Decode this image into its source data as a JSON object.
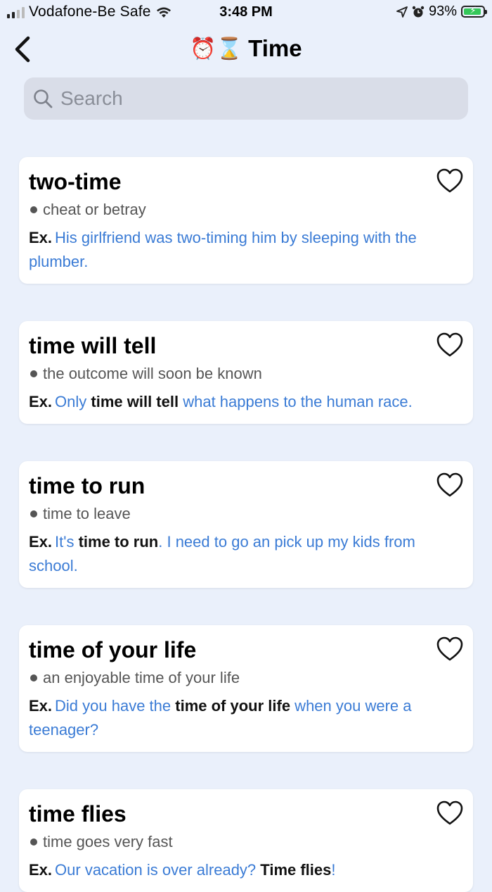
{
  "status_bar": {
    "carrier": "Vodafone-Be Safe",
    "time": "3:48 PM",
    "battery_percent": "93%",
    "battery_level": 0.93,
    "battery_color": "#34c759"
  },
  "nav": {
    "back_icon": "chevron-left-icon",
    "title_emoji": "⏰⌛",
    "title": "Time"
  },
  "search": {
    "placeholder": "Search",
    "value": ""
  },
  "colors": {
    "background": "#eaf0fb",
    "example_text": "#3a7bd5",
    "card": "#ffffff"
  },
  "example_label": "Ex.",
  "cards": [
    {
      "title": "two-time",
      "meaning": "cheat or betray",
      "example_parts": [
        {
          "text": "His girlfriend was two-timing him by sleeping with the plumber.",
          "bold": false
        }
      ],
      "favorite": false
    },
    {
      "title": "time will tell",
      "meaning": "the outcome will soon be known",
      "example_parts": [
        {
          "text": "Only ",
          "bold": false
        },
        {
          "text": "time will tell",
          "bold": true
        },
        {
          "text": " what happens to the human race.",
          "bold": false
        }
      ],
      "favorite": false
    },
    {
      "title": "time to run",
      "meaning": "time to leave",
      "example_parts": [
        {
          "text": "It's ",
          "bold": false
        },
        {
          "text": "time to run",
          "bold": true
        },
        {
          "text": ". I need to go an pick up my kids from school.",
          "bold": false
        }
      ],
      "favorite": false
    },
    {
      "title": "time of your life",
      "meaning": "an enjoyable time of your life",
      "example_parts": [
        {
          "text": "Did you have the ",
          "bold": false
        },
        {
          "text": "time of your life",
          "bold": true
        },
        {
          "text": " when you were a teenager?",
          "bold": false
        }
      ],
      "favorite": false
    },
    {
      "title": "time flies",
      "meaning": "time goes very fast",
      "example_parts": [
        {
          "text": "Our vacation is over already? ",
          "bold": false
        },
        {
          "text": "Time flies",
          "bold": true
        },
        {
          "text": "!",
          "bold": false
        }
      ],
      "favorite": false
    }
  ]
}
